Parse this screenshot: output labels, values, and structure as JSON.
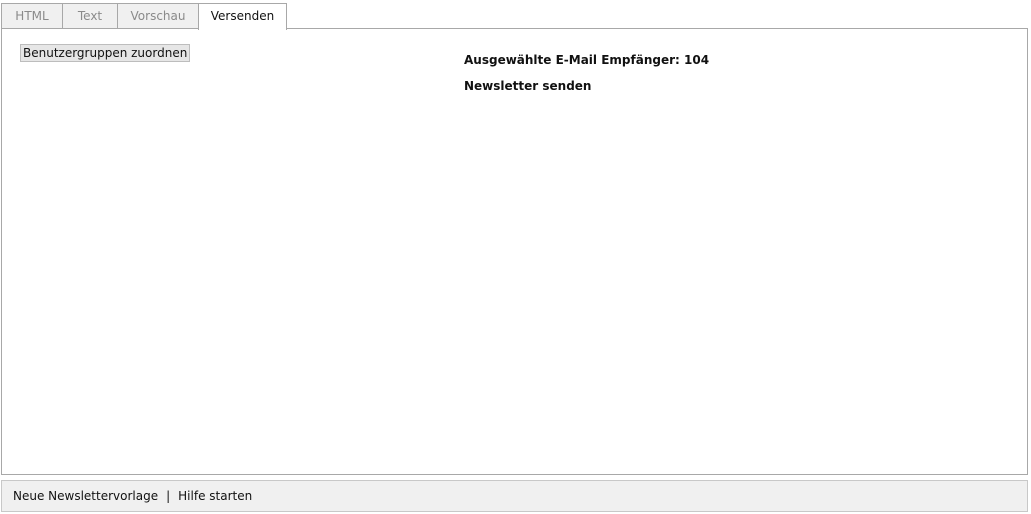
{
  "tabs": [
    {
      "label": "HTML",
      "active": false
    },
    {
      "label": "Text",
      "active": false
    },
    {
      "label": "Vorschau",
      "active": false
    },
    {
      "label": "Versenden",
      "active": true
    }
  ],
  "panel": {
    "assign_groups_button": "Benutzergruppen zuordnen",
    "recipients_label": "Ausgewählte E-Mail Empfänger: 104",
    "send_newsletter_link": "Newsletter senden"
  },
  "footer": {
    "new_template_link": "Neue Newslettervorlage",
    "separator": "|",
    "help_link": "Hilfe starten"
  },
  "colors": {
    "tab_inactive_bg": "#f0f0f0",
    "tab_inactive_text": "#8a8a8a",
    "border": "#a8a8a8",
    "footer_bg": "#f0f0f0"
  }
}
